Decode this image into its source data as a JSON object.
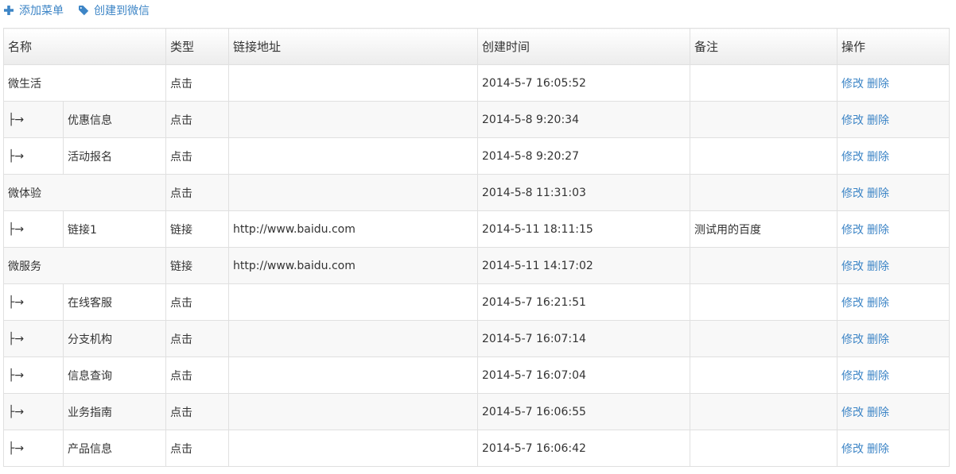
{
  "toolbar": {
    "add_menu": "添加菜单",
    "create_wechat": "创建到微信",
    "icon_add": "plus-icon",
    "icon_tag": "tag-icon"
  },
  "colors": {
    "link": "#3d85c6",
    "border": "#e0e0e0",
    "row_alt": "#f8f8f8"
  },
  "table": {
    "headers": {
      "name": "名称",
      "type": "类型",
      "url": "链接地址",
      "created": "创建时间",
      "note": "备注",
      "action": "操作"
    },
    "edit_label": "修改",
    "delete_label": "删除",
    "rows": [
      {
        "level": 1,
        "prefix": "",
        "name": "微生活",
        "type": "点击",
        "url": "",
        "created": "2014-5-7 16:05:52",
        "note": ""
      },
      {
        "level": 2,
        "prefix": "├→",
        "name": "优惠信息",
        "type": "点击",
        "url": "",
        "created": "2014-5-8 9:20:34",
        "note": ""
      },
      {
        "level": 2,
        "prefix": "├→",
        "name": "活动报名",
        "type": "点击",
        "url": "",
        "created": "2014-5-8 9:20:27",
        "note": ""
      },
      {
        "level": 1,
        "prefix": "",
        "name": "微体验",
        "type": "点击",
        "url": "",
        "created": "2014-5-8 11:31:03",
        "note": ""
      },
      {
        "level": 2,
        "prefix": "├→",
        "name": "链接1",
        "type": "链接",
        "url": "http://www.baidu.com",
        "created": "2014-5-11 18:11:15",
        "note": "测试用的百度"
      },
      {
        "level": 1,
        "prefix": "",
        "name": "微服务",
        "type": "链接",
        "url": "http://www.baidu.com",
        "created": "2014-5-11 14:17:02",
        "note": ""
      },
      {
        "level": 2,
        "prefix": "├→",
        "name": "在线客服",
        "type": "点击",
        "url": "",
        "created": "2014-5-7 16:21:51",
        "note": ""
      },
      {
        "level": 2,
        "prefix": "├→",
        "name": "分支机构",
        "type": "点击",
        "url": "",
        "created": "2014-5-7 16:07:14",
        "note": ""
      },
      {
        "level": 2,
        "prefix": "├→",
        "name": "信息查询",
        "type": "点击",
        "url": "",
        "created": "2014-5-7 16:07:04",
        "note": ""
      },
      {
        "level": 2,
        "prefix": "├→",
        "name": "业务指南",
        "type": "点击",
        "url": "",
        "created": "2014-5-7 16:06:55",
        "note": ""
      },
      {
        "level": 2,
        "prefix": "├→",
        "name": "产品信息",
        "type": "点击",
        "url": "",
        "created": "2014-5-7 16:06:42",
        "note": ""
      }
    ]
  }
}
